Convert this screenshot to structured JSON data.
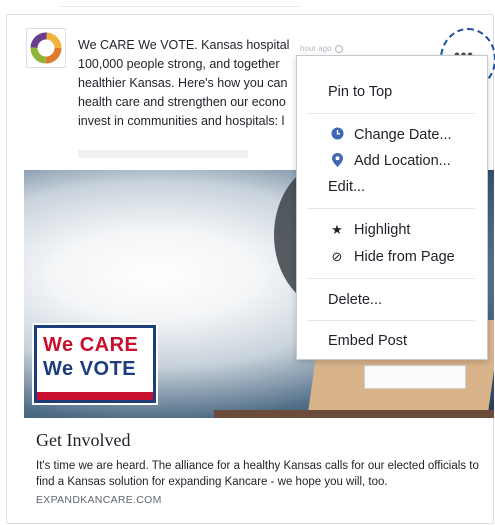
{
  "post": {
    "text_lines": [
      "We CARE We VOTE. Kansas hospital",
      "100,000 people strong, and together",
      "healthier Kansas. Here's how you can",
      "health care and strengthen our econo",
      "invest in communities and hospitals: l"
    ],
    "timestamp": "hour ago"
  },
  "image": {
    "logo_line1": "We CARE",
    "logo_line2": "We VOTE"
  },
  "link": {
    "title": "Get Involved",
    "description": "It's time we are heard. The alliance for a healthy Kansas calls for our elected officials to find a Kansas solution for expanding Kancare - we hope you will, too.",
    "domain": "EXPANDKANCARE.COM"
  },
  "menu": {
    "more_label": "•••",
    "items": [
      {
        "label": "Pin to Top",
        "icon": ""
      },
      {
        "label": "Change Date...",
        "icon": "clock-icon"
      },
      {
        "label": "Add Location...",
        "icon": "location-pin-icon"
      },
      {
        "label": "Edit...",
        "icon": ""
      },
      {
        "label": "Highlight",
        "icon": "star-icon"
      },
      {
        "label": "Hide from Page",
        "icon": "hide-icon"
      },
      {
        "label": "Delete...",
        "icon": ""
      },
      {
        "label": "Embed Post",
        "icon": ""
      }
    ]
  },
  "colors": {
    "accent_blue": "#4267b2",
    "ring": "#1a4fa0",
    "brand_red": "#c8102e",
    "brand_navy": "#1e3e7a"
  }
}
